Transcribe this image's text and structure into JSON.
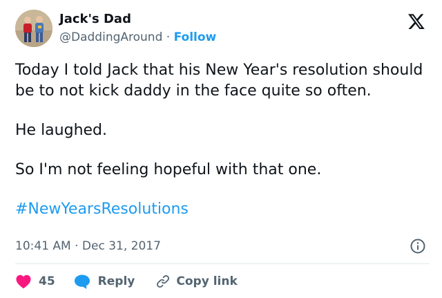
{
  "author": {
    "name": "Jack's Dad",
    "handle": "@DaddingAround",
    "separator": "·",
    "follow_label": "Follow"
  },
  "brand_icon": "x-logo-icon",
  "tweet": {
    "paragraphs": [
      "Today I told Jack that his New Year's resolution should be to not kick daddy in the face quite so often.",
      "He laughed.",
      "So I'm not feeling hopeful with that one."
    ],
    "hashtag": "#NewYearsResolutions"
  },
  "meta": {
    "time": "10:41 AM",
    "separator": "·",
    "date": "Dec 31, 2017",
    "info_icon": "info-icon"
  },
  "actions": {
    "like_count": "45",
    "like_icon": "heart-icon",
    "reply_label": "Reply",
    "reply_icon": "speech-bubble-icon",
    "copy_label": "Copy link",
    "copy_icon": "link-icon"
  },
  "colors": {
    "accent": "#1d9bf0",
    "like": "#f91880",
    "text": "#0f1419",
    "secondary": "#536471"
  }
}
